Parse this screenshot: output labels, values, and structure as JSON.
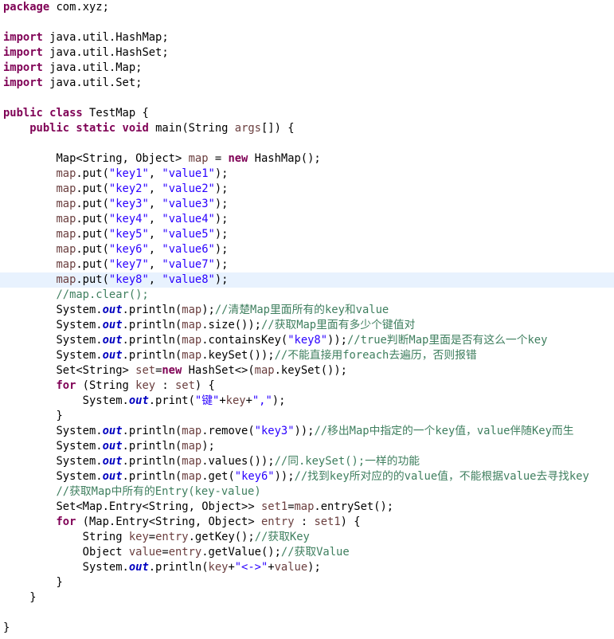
{
  "editor": {
    "highlighted_line": 18,
    "colors": {
      "background": "#ffffff",
      "current_line": "#e8f2fe",
      "keyword": "#7f0055",
      "string": "#2a00ff",
      "comment": "#3f7f5f",
      "local_variable": "#6a3e3e",
      "static_field": "#0000c0",
      "plain": "#000000"
    },
    "lines": [
      [
        [
          "k",
          "package"
        ],
        [
          "p",
          " com.xyz;"
        ]
      ],
      [],
      [
        [
          "k",
          "import"
        ],
        [
          "p",
          " java.util.HashMap;"
        ]
      ],
      [
        [
          "k",
          "import"
        ],
        [
          "p",
          " java.util.HashSet;"
        ]
      ],
      [
        [
          "k",
          "import"
        ],
        [
          "p",
          " java.util.Map;"
        ]
      ],
      [
        [
          "k",
          "import"
        ],
        [
          "p",
          " java.util.Set;"
        ]
      ],
      [],
      [
        [
          "k",
          "public"
        ],
        [
          "p",
          " "
        ],
        [
          "k",
          "class"
        ],
        [
          "p",
          " TestMap {"
        ]
      ],
      [
        [
          "p",
          "    "
        ],
        [
          "k",
          "public"
        ],
        [
          "p",
          " "
        ],
        [
          "k",
          "static"
        ],
        [
          "p",
          " "
        ],
        [
          "k",
          "void"
        ],
        [
          "p",
          " main(String "
        ],
        [
          "v",
          "args"
        ],
        [
          "p",
          "[]) {"
        ]
      ],
      [],
      [
        [
          "p",
          "        Map<String, Object> "
        ],
        [
          "v",
          "map"
        ],
        [
          "p",
          " = "
        ],
        [
          "k",
          "new"
        ],
        [
          "p",
          " HashMap();"
        ]
      ],
      [
        [
          "p",
          "        "
        ],
        [
          "v",
          "map"
        ],
        [
          "p",
          ".put("
        ],
        [
          "s",
          "\"key1\""
        ],
        [
          "p",
          ", "
        ],
        [
          "s",
          "\"value1\""
        ],
        [
          "p",
          ");"
        ]
      ],
      [
        [
          "p",
          "        "
        ],
        [
          "v",
          "map"
        ],
        [
          "p",
          ".put("
        ],
        [
          "s",
          "\"key2\""
        ],
        [
          "p",
          ", "
        ],
        [
          "s",
          "\"value2\""
        ],
        [
          "p",
          ");"
        ]
      ],
      [
        [
          "p",
          "        "
        ],
        [
          "v",
          "map"
        ],
        [
          "p",
          ".put("
        ],
        [
          "s",
          "\"key3\""
        ],
        [
          "p",
          ", "
        ],
        [
          "s",
          "\"value3\""
        ],
        [
          "p",
          ");"
        ]
      ],
      [
        [
          "p",
          "        "
        ],
        [
          "v",
          "map"
        ],
        [
          "p",
          ".put("
        ],
        [
          "s",
          "\"key4\""
        ],
        [
          "p",
          ", "
        ],
        [
          "s",
          "\"value4\""
        ],
        [
          "p",
          ");"
        ]
      ],
      [
        [
          "p",
          "        "
        ],
        [
          "v",
          "map"
        ],
        [
          "p",
          ".put("
        ],
        [
          "s",
          "\"key5\""
        ],
        [
          "p",
          ", "
        ],
        [
          "s",
          "\"value5\""
        ],
        [
          "p",
          ");"
        ]
      ],
      [
        [
          "p",
          "        "
        ],
        [
          "v",
          "map"
        ],
        [
          "p",
          ".put("
        ],
        [
          "s",
          "\"key6\""
        ],
        [
          "p",
          ", "
        ],
        [
          "s",
          "\"value6\""
        ],
        [
          "p",
          ");"
        ]
      ],
      [
        [
          "p",
          "        "
        ],
        [
          "v",
          "map"
        ],
        [
          "p",
          ".put("
        ],
        [
          "s",
          "\"key7\""
        ],
        [
          "p",
          ", "
        ],
        [
          "s",
          "\"value7\""
        ],
        [
          "p",
          ");"
        ]
      ],
      [
        [
          "p",
          "        "
        ],
        [
          "v",
          "map"
        ],
        [
          "p",
          ".put("
        ],
        [
          "s",
          "\"key8\""
        ],
        [
          "p",
          ", "
        ],
        [
          "s",
          "\"value8\""
        ],
        [
          "p",
          ");"
        ]
      ],
      [
        [
          "p",
          "        "
        ],
        [
          "c",
          "//map.clear();"
        ]
      ],
      [
        [
          "p",
          "        System."
        ],
        [
          "sf",
          "out"
        ],
        [
          "p",
          ".println("
        ],
        [
          "v",
          "map"
        ],
        [
          "p",
          ");"
        ],
        [
          "c",
          "//清楚Map里面所有的key和value"
        ]
      ],
      [
        [
          "p",
          "        System."
        ],
        [
          "sf",
          "out"
        ],
        [
          "p",
          ".println("
        ],
        [
          "v",
          "map"
        ],
        [
          "p",
          ".size());"
        ],
        [
          "c",
          "//获取Map里面有多少个键值对"
        ]
      ],
      [
        [
          "p",
          "        System."
        ],
        [
          "sf",
          "out"
        ],
        [
          "p",
          ".println("
        ],
        [
          "v",
          "map"
        ],
        [
          "p",
          ".containsKey("
        ],
        [
          "s",
          "\"key8\""
        ],
        [
          "p",
          "));"
        ],
        [
          "c",
          "//true判断Map里面是否有这么一个key"
        ]
      ],
      [
        [
          "p",
          "        System."
        ],
        [
          "sf",
          "out"
        ],
        [
          "p",
          ".println("
        ],
        [
          "v",
          "map"
        ],
        [
          "p",
          ".keySet());"
        ],
        [
          "c",
          "//不能直接用foreach去遍历，否则报错"
        ]
      ],
      [
        [
          "p",
          "        Set<String> "
        ],
        [
          "v",
          "set"
        ],
        [
          "p",
          "="
        ],
        [
          "k",
          "new"
        ],
        [
          "p",
          " HashSet<>("
        ],
        [
          "v",
          "map"
        ],
        [
          "p",
          ".keySet());"
        ]
      ],
      [
        [
          "p",
          "        "
        ],
        [
          "k",
          "for"
        ],
        [
          "p",
          " (String "
        ],
        [
          "v",
          "key"
        ],
        [
          "p",
          " : "
        ],
        [
          "v",
          "set"
        ],
        [
          "p",
          ") {"
        ]
      ],
      [
        [
          "p",
          "            System."
        ],
        [
          "sf",
          "out"
        ],
        [
          "p",
          ".print("
        ],
        [
          "s",
          "\"键\""
        ],
        [
          "p",
          "+"
        ],
        [
          "v",
          "key"
        ],
        [
          "p",
          "+"
        ],
        [
          "s",
          "\",\""
        ],
        [
          "p",
          ");"
        ]
      ],
      [
        [
          "p",
          "        }"
        ]
      ],
      [
        [
          "p",
          "        System."
        ],
        [
          "sf",
          "out"
        ],
        [
          "p",
          ".println("
        ],
        [
          "v",
          "map"
        ],
        [
          "p",
          ".remove("
        ],
        [
          "s",
          "\"key3\""
        ],
        [
          "p",
          "));"
        ],
        [
          "c",
          "//移出Map中指定的一个key值，value伴随Key而生"
        ]
      ],
      [
        [
          "p",
          "        System."
        ],
        [
          "sf",
          "out"
        ],
        [
          "p",
          ".println("
        ],
        [
          "v",
          "map"
        ],
        [
          "p",
          ");"
        ]
      ],
      [
        [
          "p",
          "        System."
        ],
        [
          "sf",
          "out"
        ],
        [
          "p",
          ".println("
        ],
        [
          "v",
          "map"
        ],
        [
          "p",
          ".values());"
        ],
        [
          "c",
          "//同.keySet();一样的功能"
        ]
      ],
      [
        [
          "p",
          "        System."
        ],
        [
          "sf",
          "out"
        ],
        [
          "p",
          ".println("
        ],
        [
          "v",
          "map"
        ],
        [
          "p",
          ".get("
        ],
        [
          "s",
          "\"key6\""
        ],
        [
          "p",
          "));"
        ],
        [
          "c",
          "//找到key所对应的的value值，不能根据value去寻找key"
        ]
      ],
      [
        [
          "p",
          "        "
        ],
        [
          "c",
          "//获取Map中所有的Entry(key-value)"
        ]
      ],
      [
        [
          "p",
          "        Set<Map.Entry<String, Object>> "
        ],
        [
          "v",
          "set1"
        ],
        [
          "p",
          "="
        ],
        [
          "v",
          "map"
        ],
        [
          "p",
          ".entrySet();"
        ]
      ],
      [
        [
          "p",
          "        "
        ],
        [
          "k",
          "for"
        ],
        [
          "p",
          " (Map.Entry<String, Object> "
        ],
        [
          "v",
          "entry"
        ],
        [
          "p",
          " : "
        ],
        [
          "v",
          "set1"
        ],
        [
          "p",
          ") {"
        ]
      ],
      [
        [
          "p",
          "            String "
        ],
        [
          "v",
          "key"
        ],
        [
          "p",
          "="
        ],
        [
          "v",
          "entry"
        ],
        [
          "p",
          ".getKey();"
        ],
        [
          "c",
          "//获取Key"
        ]
      ],
      [
        [
          "p",
          "            Object "
        ],
        [
          "v",
          "value"
        ],
        [
          "p",
          "="
        ],
        [
          "v",
          "entry"
        ],
        [
          "p",
          ".getValue();"
        ],
        [
          "c",
          "//获取Value"
        ]
      ],
      [
        [
          "p",
          "            System."
        ],
        [
          "sf",
          "out"
        ],
        [
          "p",
          ".println("
        ],
        [
          "v",
          "key"
        ],
        [
          "p",
          "+"
        ],
        [
          "s",
          "\"<->\""
        ],
        [
          "p",
          "+"
        ],
        [
          "v",
          "value"
        ],
        [
          "p",
          ");"
        ]
      ],
      [
        [
          "p",
          "        }"
        ]
      ],
      [
        [
          "p",
          "    }"
        ]
      ],
      [],
      [
        [
          "p",
          "}"
        ]
      ]
    ]
  }
}
